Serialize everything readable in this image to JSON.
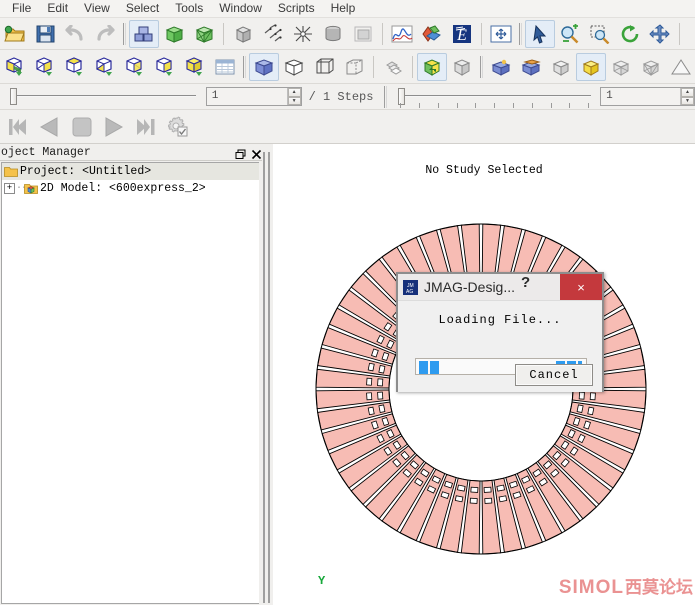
{
  "menubar": {
    "items": [
      {
        "label": "File",
        "name": "menu-file"
      },
      {
        "label": "Edit",
        "name": "menu-edit"
      },
      {
        "label": "View",
        "name": "menu-view"
      },
      {
        "label": "Select",
        "name": "menu-select"
      },
      {
        "label": "Tools",
        "name": "menu-tools"
      },
      {
        "label": "Window",
        "name": "menu-window"
      },
      {
        "label": "Scripts",
        "name": "menu-scripts"
      },
      {
        "label": "Help",
        "name": "menu-help"
      }
    ]
  },
  "toolbar1": {
    "icons": [
      "open-folder-icon",
      "save-disk-icon",
      "undo-icon",
      "redo-icon",
      "geometry-parts-icon",
      "green-box-icon",
      "green-mesh-box-icon",
      "gray-box-icon",
      "scatter-arrows-icon",
      "mesh-star-icon",
      "database-cylinder-icon",
      "gray-square-icon",
      "graph-curve-icon",
      "results-icon",
      "express-e-icon",
      "fit-window-icon",
      "select-arrow-icon",
      "zoom-in-icon",
      "zoom-region-icon",
      "rotate-icon",
      "pan-icon"
    ]
  },
  "toolbar2": {
    "icons": [
      "view-iso1-icon",
      "view-iso2-icon",
      "view-iso3-icon",
      "view-iso4-icon",
      "view-iso5-icon",
      "view-iso6-icon",
      "view-iso7-icon",
      "view-table-icon",
      "shaded-solid-icon",
      "wireframe-box-icon",
      "wireframe-edges-icon",
      "hidden-line-icon",
      "layers-icon",
      "green-swap-icon",
      "gray-shade-icon",
      "blue-light-icon",
      "blue-plane-icon",
      "gray-cube-icon",
      "yellow-cube-icon",
      "gray-xmesh-icon",
      "gray-xmesh2-icon",
      "triangle-icon"
    ]
  },
  "step_slider": {
    "value": "1",
    "steps_label": "/ 1 Steps"
  },
  "time_slider": {
    "value": "1"
  },
  "playback": {
    "buttons": [
      {
        "name": "skip-first-button",
        "icon": "skip-first-icon"
      },
      {
        "name": "step-back-button",
        "icon": "play-back-icon"
      },
      {
        "name": "stop-button",
        "icon": "stop-icon"
      },
      {
        "name": "play-button",
        "icon": "play-icon"
      },
      {
        "name": "skip-last-button",
        "icon": "skip-last-icon"
      },
      {
        "name": "animation-settings-button",
        "icon": "gear-check-icon"
      }
    ]
  },
  "project_panel": {
    "title": "oject Manager",
    "restore_icon": "restore-window-icon",
    "close_icon": "close-icon",
    "tree": [
      {
        "label": "Project: <Untitled>",
        "expander": "",
        "selected": true,
        "name": "tree-item-project"
      },
      {
        "label": "2D Model: <600express_2>",
        "expander": "+",
        "selected": false,
        "name": "tree-item-2d-model"
      }
    ]
  },
  "canvas": {
    "no_study_text": "No Study Selected",
    "axis_label": "Y",
    "model_fill": "#f7bcb4",
    "model_stroke": "#000000",
    "watermark_latin": "SIMOL",
    "watermark_cjk": "西莫论坛",
    "watermark_color": "#e98d8d"
  },
  "dialog": {
    "title": "JMAG-Desig...",
    "icon": "jmag-app-icon",
    "help_label": "?",
    "close_label": "×",
    "close_color": "#c4393d",
    "message": "Loading File...",
    "progress_color": "#2e9bef",
    "cancel_label": "Cancel"
  }
}
